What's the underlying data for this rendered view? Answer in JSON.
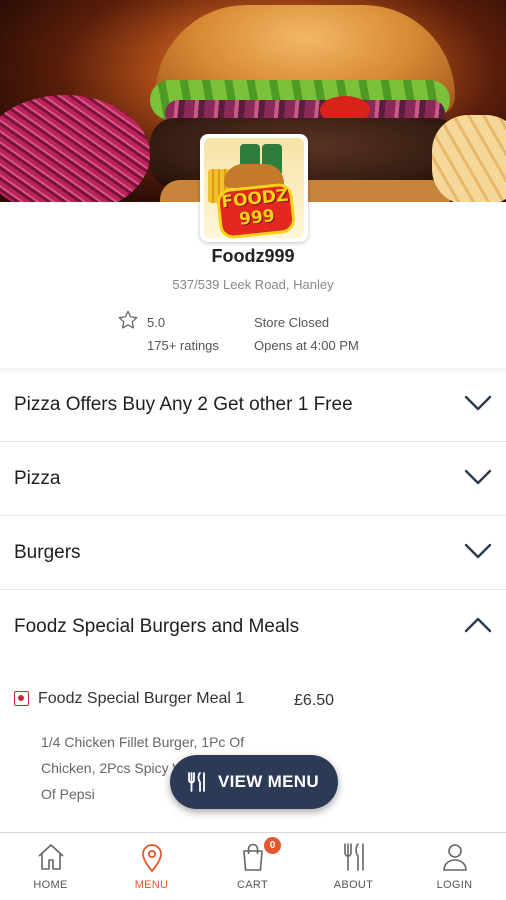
{
  "store": {
    "name": "Foodz999",
    "address": "537/539 Leek Road, Hanley",
    "rating": "5.0",
    "rating_count": "175+ ratings",
    "status": "Store Closed",
    "opens": "Opens at 4:00 PM",
    "logo_text": "FOODZ\n999"
  },
  "categories": [
    {
      "label": "Pizza Offers Buy Any 2 Get other 1 Free",
      "expanded": false
    },
    {
      "label": "Pizza",
      "expanded": false
    },
    {
      "label": "Burgers",
      "expanded": false
    },
    {
      "label": "Foodz Special Burgers and Meals",
      "expanded": true
    }
  ],
  "item": {
    "name": "Foodz Special Burger Meal 1",
    "price": "£6.50",
    "description": "1/4 Chicken Fillet Burger, 1Pc Of Chicken, 2Pcs Spicy Wings, And Can Of Pepsi"
  },
  "view_menu": {
    "label": "VIEW MENU",
    "icon": "cutlery-icon"
  },
  "bottom_nav": {
    "items": [
      {
        "label": "HOME",
        "icon": "home-icon",
        "active": false
      },
      {
        "label": "MENU",
        "icon": "location-pin-icon",
        "active": true
      },
      {
        "label": "CART",
        "icon": "shopping-bag-icon",
        "active": false,
        "badge": "0"
      },
      {
        "label": "ABOUT",
        "icon": "cutlery-icon",
        "active": false
      },
      {
        "label": "LOGIN",
        "icon": "user-icon",
        "active": false
      }
    ]
  },
  "colors": {
    "accent": "#e4572e",
    "button_bg": "#2d3a55",
    "veg_marker": "#c4302b"
  }
}
